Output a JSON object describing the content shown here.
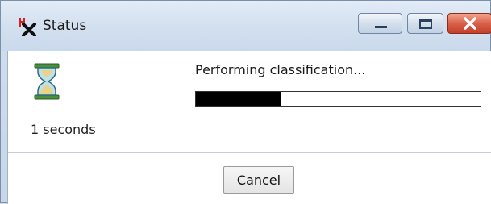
{
  "window": {
    "title": "Status",
    "controls": {
      "minimize": "minimize",
      "maximize": "maximize",
      "close": "close"
    }
  },
  "status": {
    "elapsed_text": "1 seconds",
    "message": "Performing classification...",
    "progress_fraction": 0.3
  },
  "buttons": {
    "cancel_label": "Cancel"
  },
  "icons": {
    "app": "status-app-icon",
    "hourglass": "hourglass-icon"
  },
  "colors": {
    "progress_fill": "#000000",
    "close_button": "#d8614a"
  }
}
